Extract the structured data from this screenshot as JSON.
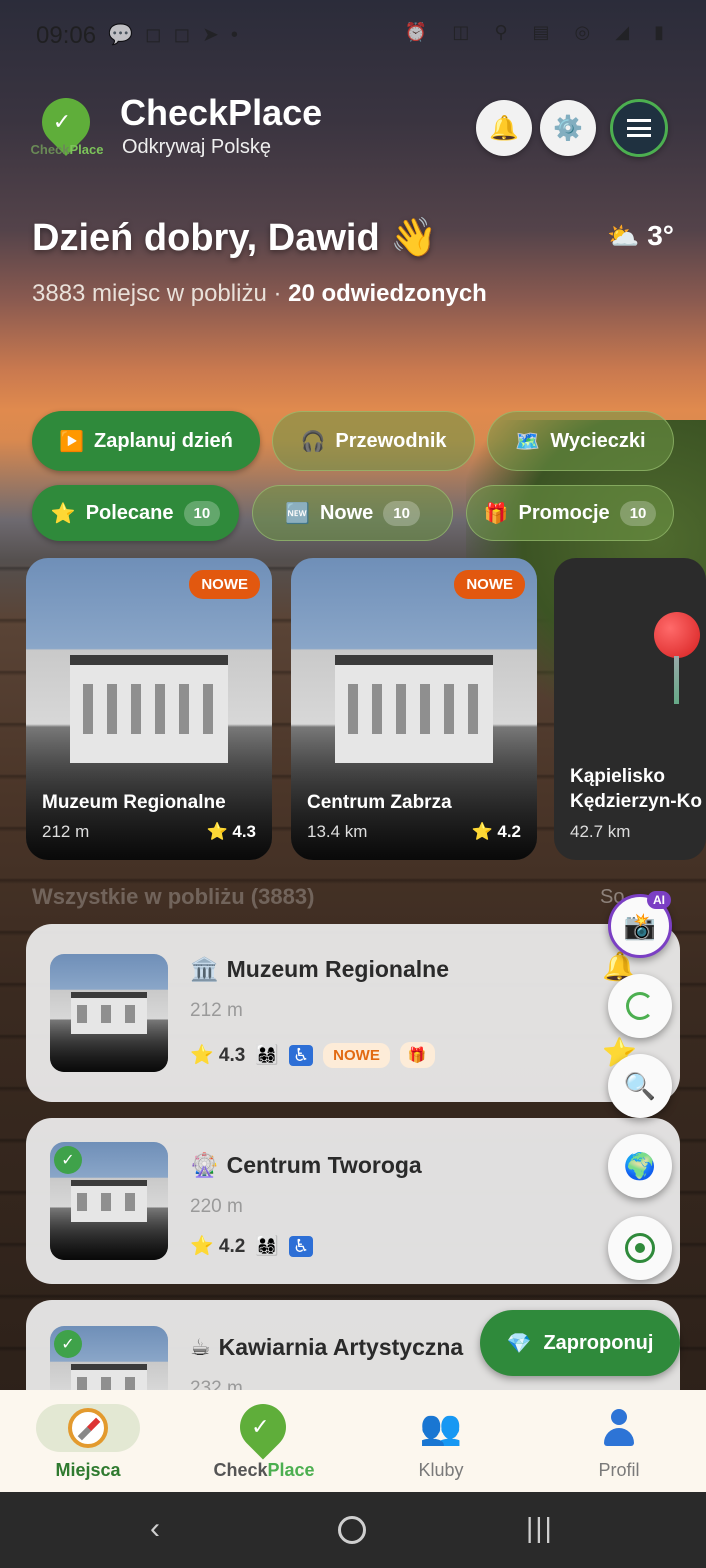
{
  "status_bar": {
    "time": "09:06",
    "left_icons": [
      "message-icon",
      "instagram-icon",
      "instagram-icon",
      "telegram-icon",
      "dot-icon"
    ],
    "right_icons": [
      "alarm-icon",
      "nfc-icon",
      "location-icon",
      "volte-icon",
      "hotspot-icon",
      "5g-signal-icon",
      "battery-icon"
    ]
  },
  "header": {
    "logo_text_a": "Check",
    "logo_text_b": "Place",
    "title": "CheckPlace",
    "subtitle": "Odkrywaj Polskę"
  },
  "greeting": {
    "text": "Dzień dobry, Dawid 👋",
    "weather_icon": "⛅",
    "temperature": "3°",
    "stats_prefix": "3883 miejsc w pobliżu · ",
    "stats_visited": "20 odwiedzonych"
  },
  "quick_actions": [
    {
      "icon": "▶️",
      "label": "Zaplanuj dzień"
    },
    {
      "icon": "🎧",
      "label": "Przewodnik"
    },
    {
      "icon": "🗺️",
      "label": "Wycieczki"
    }
  ],
  "filters": [
    {
      "icon": "⭐",
      "label": "Polecane",
      "count": "10"
    },
    {
      "icon": "🆕",
      "label": "Nowe",
      "count": "10"
    },
    {
      "icon": "🎁",
      "label": "Promocje",
      "count": "10"
    }
  ],
  "featured": [
    {
      "badge": "NOWE",
      "name": "Muzeum Regionalne",
      "distance": "212 m",
      "rating": "⭐ 4.3"
    },
    {
      "badge": "NOWE",
      "name": "Centrum Zabrza",
      "distance": "13.4 km",
      "rating": "⭐ 4.2"
    },
    {
      "name_line1": "Kąpielisko",
      "name_line2": "Kędzierzyn-Ko",
      "distance": "42.7 km"
    }
  ],
  "section": {
    "title": "Wszystkie w pobliżu (3883)",
    "sort_label": "So"
  },
  "places": [
    {
      "category_icon": "🏛️",
      "name": "Muzeum Regionalne",
      "distance": "212 m",
      "rating": "⭐ 4.3",
      "family": "👨‍👩‍👧‍👦",
      "accessible": "♿",
      "new_tag": "NOWE",
      "gift": "🎁"
    },
    {
      "visited": "✓",
      "category_icon": "🎡",
      "name": "Centrum Tworoga",
      "distance": "220 m",
      "rating": "⭐ 4.2",
      "family": "👨‍👩‍👧‍👦",
      "accessible": "♿"
    },
    {
      "visited": "✓",
      "category_icon": "☕",
      "name": "Kawiarnia Artystyczna",
      "distance": "232 m"
    }
  ],
  "floating": {
    "ai_icon": "📸",
    "ai_badge": "AI",
    "search_icon": "🔍",
    "globe_icon": "🌍",
    "side_bell": "🔔",
    "side_star": "⭐"
  },
  "propose": {
    "icon": "💎",
    "label": "Zaproponuj"
  },
  "bottom_nav": {
    "places": "Miejsca",
    "logo_a": "Check",
    "logo_b": "Place",
    "clubs_icon": "👥",
    "clubs": "Kluby",
    "profile": "Profil"
  },
  "system_nav": {
    "back": "‹",
    "recent": "|||"
  },
  "colors": {
    "primary_green": "#2f8a3b",
    "badge_orange": "#e2580f",
    "ai_purple": "#7b3fc4",
    "nav_bg": "#fcf7ee"
  }
}
